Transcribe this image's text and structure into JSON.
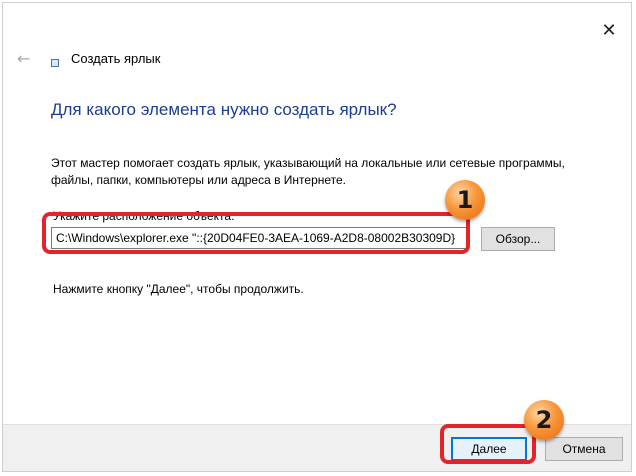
{
  "window": {
    "close_icon": "✕",
    "back_icon": "←",
    "title": "Создать ярлык"
  },
  "main": {
    "heading": "Для какого элемента нужно создать ярлык?",
    "description": "Этот мастер помогает создать ярлык, указывающий на локальные или сетевые программы, файлы, папки, компьютеры или адреса в Интернете.",
    "location_label": "Укажите расположение объекта:",
    "location_value": "C:\\Windows\\explorer.exe \"::{20D04FE0-3AEA-1069-A2D8-08002B30309D}",
    "browse_label": "Обзор...",
    "hint": "Нажмите кнопку \"Далее\", чтобы продолжить."
  },
  "footer": {
    "next_label": "Далее",
    "cancel_label": "Отмена"
  },
  "annotations": {
    "badge_1": "1",
    "badge_2": "2",
    "highlight_color": "#e5232a",
    "badge_color": "#f7963a"
  }
}
